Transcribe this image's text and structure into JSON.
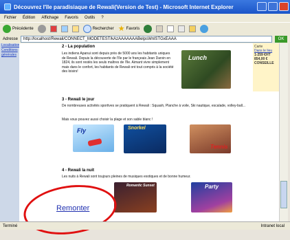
{
  "window": {
    "title": "Découvrez l'île paradisiaque de Rewali(Version de Test) - Microsoft Internet Explorer"
  },
  "menu": [
    "Fichier",
    "Édition",
    "Affichage",
    "Favoris",
    "Outils",
    "?"
  ],
  "toolbar": {
    "back_label": "Précédente",
    "search_label": "Rechercher",
    "favorites_label": "Favoris"
  },
  "address": {
    "label": "Adresse",
    "value": "http://localhost/Rewali/CONNECT_MODETEST/kAzAAAAAAABelpsWnlSTGxEAAA",
    "go_label": "OK"
  },
  "sidebar": {
    "links": [
      "Localisation",
      "Conditions générales"
    ]
  },
  "right_box": {
    "line1": "Carte",
    "link": "Dans le lieu",
    "price1": "1-259 €HT",
    "price2": "854,00 €",
    "price3": "CONSEILLE"
  },
  "sections": {
    "population": {
      "title": "2 - La population",
      "text": "Les indiens Apanui sont depuis près de 5000 ans les habitants uniques de Rewali. Depuis la découverte de l'île par le françeais Jean Darvin en 1824, ils sont restés les seuls maîtres de l'île. Aimant vivre simplement mais dans le confort, les habitants de Rewali ont tout compris à la société des loisirs!",
      "image_label": "Lunch"
    },
    "jour": {
      "title": "3 - Rewali le jour",
      "text1": "De nombreuses activités sportives se pratiquent à Rewali : Squash, Planche à voile, Ski nautique, escalade, volley-ball...",
      "text2": "Mais vous pouvez aussi choisir la plage et son sable blanc !",
      "images": [
        "Fly",
        "Snorkel",
        "Tennis"
      ]
    },
    "nuit": {
      "title": "4 - Rewali la nuit",
      "text": "Les nuits à Rewali sont toujours pleines de musiques exotiques et de bonne humeur.",
      "images": [
        "Romantic Sunset",
        "Party"
      ]
    }
  },
  "remonter_label": "Remonter",
  "status": {
    "text": "Terminé",
    "zone": "Intranet local"
  }
}
